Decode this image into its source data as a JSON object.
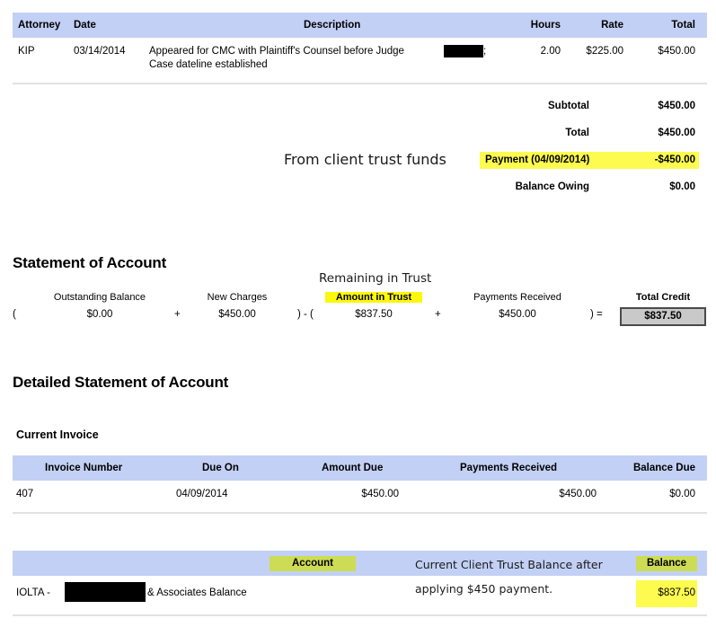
{
  "time_entries_table": {
    "columns": [
      "Attorney",
      "Date",
      "Description",
      "Hours",
      "Rate",
      "Total"
    ],
    "rows": [
      {
        "attorney": "KIP",
        "date": "03/14/2014",
        "description_line1": "Appeared for CMC with Plaintiff's Counsel before Judge",
        "description_line1_tail": ";",
        "description_line2": "Case dateline established",
        "hours": "2.00",
        "rate": "$225.00",
        "total": "$450.00"
      }
    ]
  },
  "totals": {
    "subtotal_label": "Subtotal",
    "subtotal_value": "$450.00",
    "total_label": "Total",
    "total_value": "$450.00",
    "payment_label": "Payment (04/09/2014)",
    "payment_value": "-$450.00",
    "balance_owing_label": "Balance Owing",
    "balance_owing_value": "$0.00",
    "payment_annotation": "From client trust funds"
  },
  "statement_of_account": {
    "heading": "Statement of Account",
    "trust_annotation": "Remaining in Trust",
    "columns": [
      "Outstanding Balance",
      "New Charges",
      "Amount in Trust",
      "Payments Received",
      "Total Credit"
    ],
    "values": [
      "$0.00",
      "$450.00",
      "$837.50",
      "$450.00",
      "$837.50"
    ],
    "operators": {
      "open_paren_1": "(",
      "plus_1": "+",
      "close_open": ") - (",
      "plus_2": "+",
      "close_equals": ") ="
    }
  },
  "detailed_statement": {
    "heading": "Detailed Statement of Account",
    "section_label": "Current Invoice",
    "columns": [
      "Invoice Number",
      "Due On",
      "Amount Due",
      "Payments Received",
      "Balance Due"
    ],
    "rows": [
      {
        "invoice_number": "407",
        "due_on": "04/09/2014",
        "amount_due": "$450.00",
        "payments_received": "$450.00",
        "balance_due": "$0.00"
      }
    ]
  },
  "trust_account": {
    "columns": [
      "Account",
      "Balance"
    ],
    "rows": [
      {
        "account_prefix": "IOLTA - ",
        "account_suffix": "& Associates Balance",
        "balance": "$837.50"
      }
    ],
    "annotation_line1": "Current Client Trust Balance after",
    "annotation_line2": "applying $450 payment."
  },
  "colors": {
    "header_blue": "#c3d0f5",
    "highlight_yellow": "#fbf80b",
    "highlight_yellow_soft": "#fdfb4f",
    "highlight_olive": "#cddc55",
    "credit_box_fill": "#c9c9c9",
    "rule_grey": "#e2e2e2",
    "redaction_black": "#000000"
  }
}
